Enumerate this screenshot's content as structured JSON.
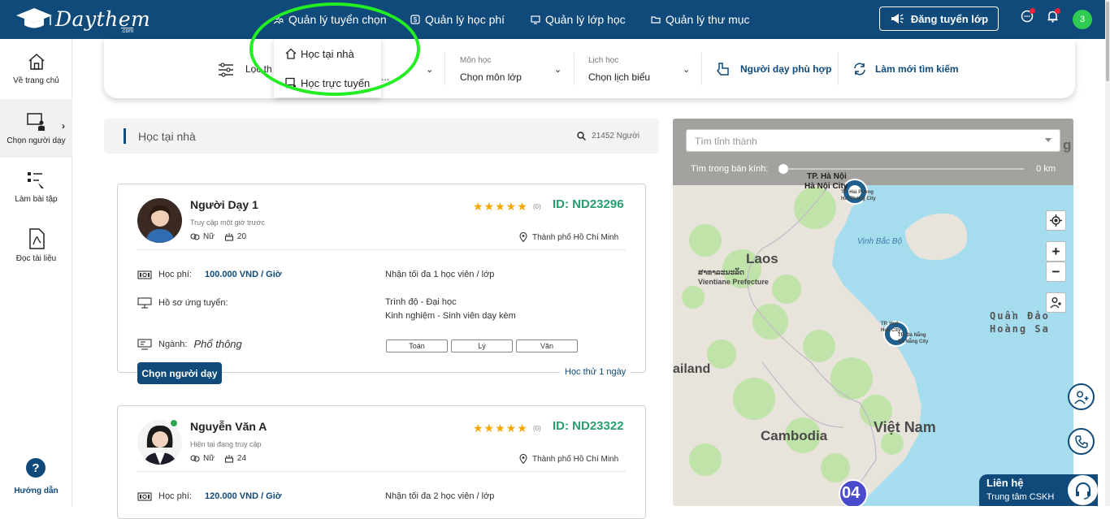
{
  "brand": {
    "name": "Daythem",
    "suffix": ".com"
  },
  "topnav": {
    "items": [
      {
        "label": "Quản lý tuyển chọn",
        "icon": "people-search-icon"
      },
      {
        "label": "Quản lý học phí",
        "icon": "money-icon"
      },
      {
        "label": "Quản lý lớp học",
        "icon": "classroom-icon"
      },
      {
        "label": "Quản lý thư mục",
        "icon": "folder-icon"
      }
    ],
    "post_button": "Đăng tuyển lớp",
    "avatar_initial": "3"
  },
  "dropdown": {
    "items": [
      "Học tại nhà",
      "Học trực tuyến"
    ]
  },
  "sidebar": {
    "items": [
      {
        "label": "Về trang chủ",
        "icon": "home-icon"
      },
      {
        "label": "Chọn người dạy",
        "icon": "teacher-icon"
      },
      {
        "label": "Làm bài tập",
        "icon": "homework-icon"
      },
      {
        "label": "Đọc tài liệu",
        "icon": "pdf-icon"
      }
    ],
    "help": "Hướng dẫn"
  },
  "filter": {
    "filter_label_visible": "Lọc th",
    "hidden_value_fragment": "...",
    "subject_label": "Môn học",
    "subject_value": "Chọn môn lớp",
    "schedule_label": "Lịch học",
    "schedule_value": "Chọn lịch biểu",
    "suitable": "Người dạy phù hợp",
    "refresh": "Làm mới tìm kiếm"
  },
  "list": {
    "title": "Học tại nhà",
    "count": "21452 Người"
  },
  "cards": [
    {
      "name": "Người Dạy 1",
      "access": "Truy cập một giờ trước",
      "gender": "Nữ",
      "age": "20",
      "stars": "★★★★★",
      "rating_count": "(0)",
      "id": "ID: ND23296",
      "city": "Thành phố Hồ Chí Minh",
      "fee_label": "Học phí:",
      "fee": "100.000 VND / Giờ",
      "capacity": "Nhận tối đa 1 học viên / lớp",
      "profile_label": "Hồ sơ ứng tuyển:",
      "level": "Trình độ - Đại học",
      "experience": "Kinh nghiệm - Sinh viên dạy kèm",
      "major_label": "Ngành:",
      "major": "Phổ thông",
      "subjects": [
        "Toán",
        "Lý",
        "Văn"
      ],
      "choose": "Chọn người dạy",
      "trial": "Học thử 1 ngày"
    },
    {
      "name": "Nguyễn Văn A",
      "access": "Hiện tại đang truy cập",
      "gender": "Nữ",
      "age": "24",
      "stars": "★★★★★",
      "rating_count": "(0)",
      "id": "ID: ND23322",
      "city": "Thành phố Hồ Chí Minh",
      "fee_label": "Học phí:",
      "fee": "120.000 VND / Giờ",
      "capacity": "Nhận tối đa 2 học viên / lớp"
    }
  ],
  "map": {
    "search_placeholder": "Tìm tỉnh thành",
    "radius_label": "Tìm trong bán kính:",
    "radius_value": "0 km",
    "zoom_in": "+",
    "zoom_out": "−",
    "cluster_count": "04",
    "labels": {
      "hanoi": "TP. Hà Nội",
      "hanoi2": "Hà Nội City",
      "haiphong": "TP. Hải Phòng",
      "haiphong2": "Hải Phòng City",
      "gulf": "Vịnh Bắc Bộ",
      "laos": "Laos",
      "laos_native": "ສາທາລະນະລັດ",
      "vientiane": "Vientiane Prefecture",
      "hue": "TP. Huế",
      "hue2": "Hue City",
      "danang": "TP. Đà Nẵng",
      "danang2": "Đà Nẵng City",
      "paracel1": "Quần Đảo",
      "paracel2": "Hoàng Sa",
      "thailand": "ailand",
      "vietnam": "Việt Nam",
      "cambodia": "Cambodia",
      "g": "g"
    }
  },
  "support": {
    "title": "Liên hệ",
    "subtitle": "Trung tâm CSKH"
  }
}
